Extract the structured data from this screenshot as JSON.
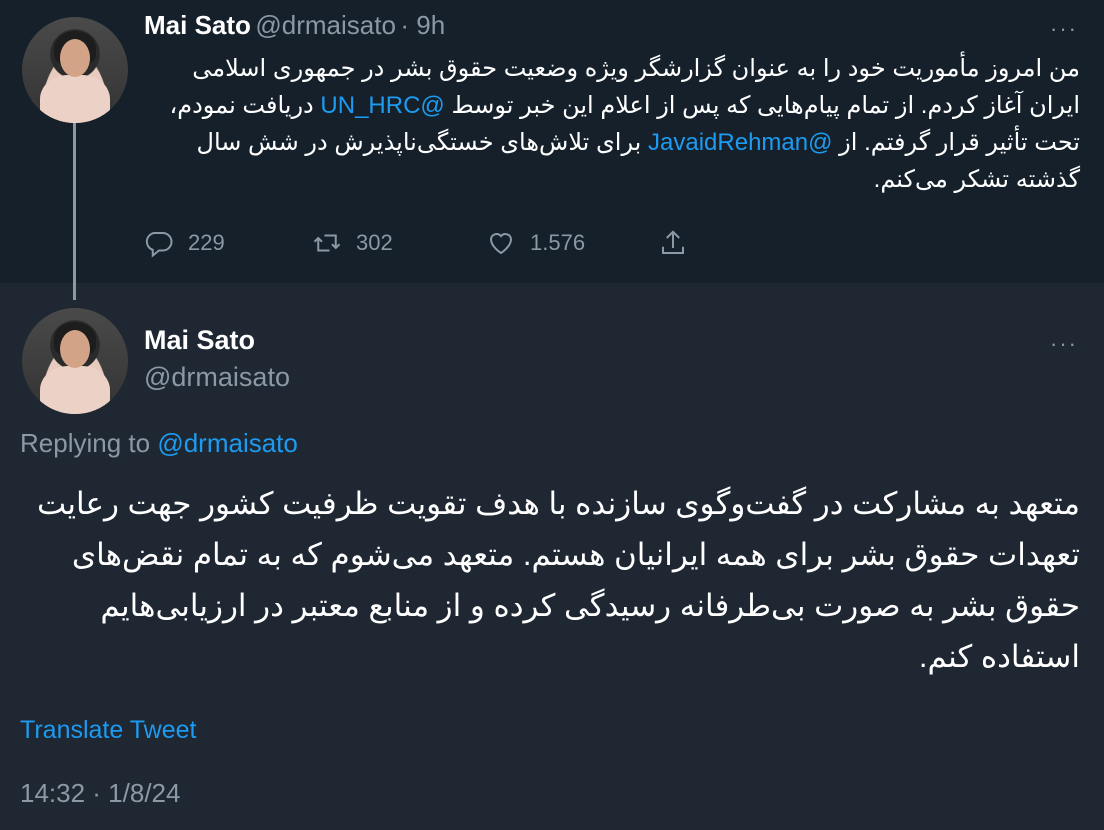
{
  "tweet1": {
    "name": "Mai Sato",
    "handle": "@drmaisato",
    "time": "· 9h",
    "text_part1": "من امروز مأموریت خود را به عنوان گزارشگر ویژه وضعیت حقوق بشر در جمهوری اسلامی ایران آغاز کردم. از تمام پیام‌هایی که پس از اعلام این خبر توسط ",
    "mention1": "@UN_HRC",
    "text_part2": " دریافت نمودم، تحت تأثیر قرار گرفتم. از ",
    "mention2": "@JavaidRehman",
    "text_part3": " برای تلاش‌های خستگی‌ناپذیرش در شش سال گذشته تشکر می‌کنم.",
    "replies": "229",
    "retweets": "302",
    "likes": "1.576"
  },
  "tweet2": {
    "name": "Mai Sato",
    "handle": "@drmaisato",
    "replying_prefix": "Replying to ",
    "replying_to": "@drmaisato",
    "text": "متعهد به مشارکت در گفت‌وگوی سازنده  با هدف تقویت ظرفیت کشور جهت رعایت تعهدات حقوق بشر برای همه ایرانیان هستم. متعهد می‌شوم که به تمام نقض‌های حقوق بشر به صورت بی‌طرفانه رسیدگی کرده و از منابع معتبر در ارزیابی‌هایم استفاده کنم.",
    "translate_label": "Translate Tweet",
    "timestamp": "14:32 · 1/8/24"
  },
  "icons": {
    "reply": "reply-icon",
    "retweet": "retweet-icon",
    "like": "heart-icon",
    "share": "share-icon",
    "more": "more-icon"
  },
  "colors": {
    "background_top": "#15202b",
    "background_bottom": "#1e2732",
    "accent": "#1d9bf0",
    "muted": "#8b98a5"
  }
}
